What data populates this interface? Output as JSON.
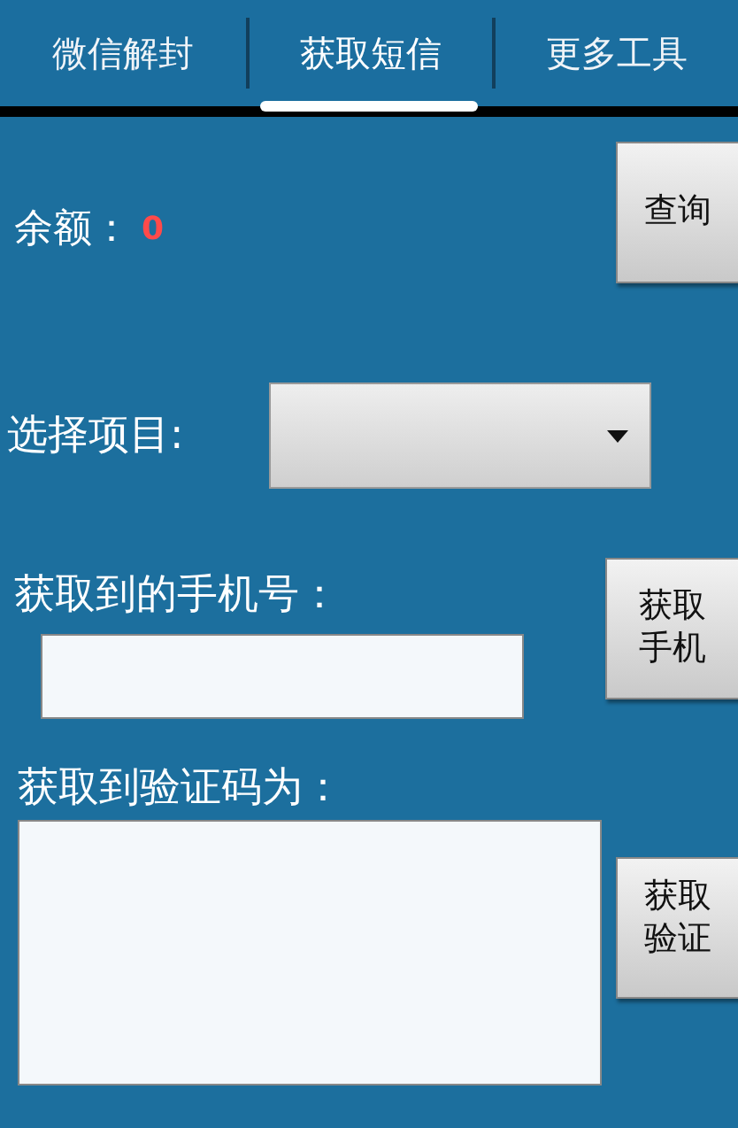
{
  "tabs": [
    {
      "label": "微信解封",
      "selected": false
    },
    {
      "label": "获取短信",
      "selected": true
    },
    {
      "label": "更多工具",
      "selected": false
    }
  ],
  "balance": {
    "label": "余额：",
    "value": "0",
    "button": "查询"
  },
  "project": {
    "label": "选择项目:"
  },
  "phone": {
    "label": "获取到的手机号：",
    "button": [
      "获取",
      "手机"
    ]
  },
  "code": {
    "label": "获取到验证码为：",
    "button": [
      "获取",
      "验证"
    ]
  }
}
